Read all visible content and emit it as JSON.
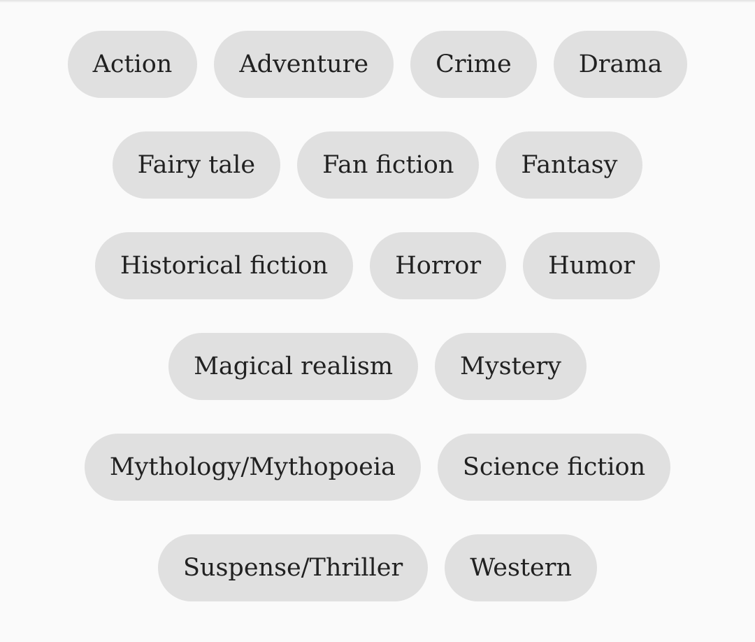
{
  "colors": {
    "background": "#fafafa",
    "chip_background": "#e0e0e0",
    "chip_text": "#212121"
  },
  "genre_chips": {
    "rows": [
      [
        "Action",
        "Adventure",
        "Crime",
        "Drama"
      ],
      [
        "Fairy tale",
        "Fan fiction",
        "Fantasy"
      ],
      [
        "Historical fiction",
        "Horror",
        "Humor"
      ],
      [
        "Magical realism",
        "Mystery"
      ],
      [
        "Mythology/Mythopoeia",
        "Science fiction"
      ],
      [
        "Suspense/Thriller",
        "Western"
      ]
    ]
  }
}
